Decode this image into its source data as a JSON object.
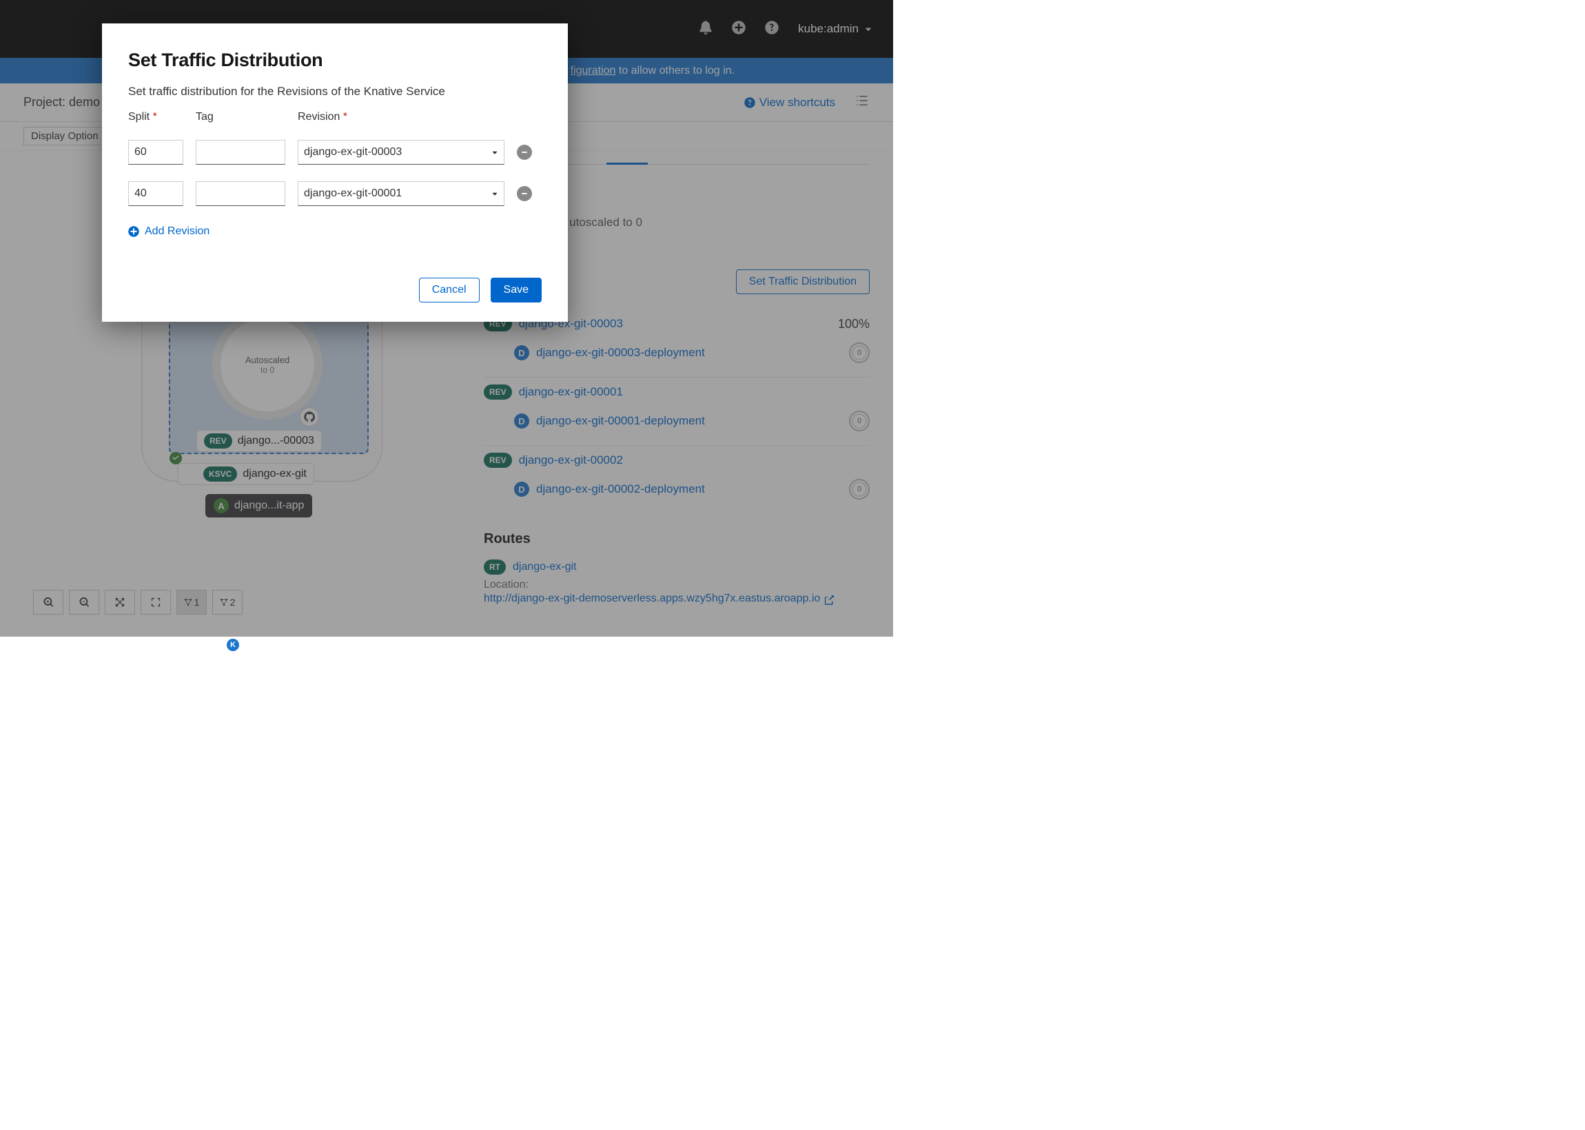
{
  "header": {
    "user": "kube:admin"
  },
  "bluebar": {
    "link": "figuration",
    "afterText": " to allow others to log in."
  },
  "subhead": {
    "projectLabel": "Project: demo",
    "viewShortcuts": "View shortcuts"
  },
  "filters": {
    "displayOptions": "Display Option"
  },
  "modal": {
    "title": "Set Traffic Distribution",
    "desc": "Set traffic distribution for the Revisions of the Knative Service",
    "labels": {
      "split": "Split",
      "tag": "Tag",
      "revision": "Revision"
    },
    "rows": [
      {
        "split": "60",
        "tag": "",
        "revision": "django-ex-git-00003"
      },
      {
        "split": "40",
        "tag": "",
        "revision": "django-ex-git-00001"
      }
    ],
    "addRevision": "Add Revision",
    "cancel": "Cancel",
    "save": "Save"
  },
  "topology": {
    "autoscaled1": "Autoscaled",
    "autoscaled2": "to 0",
    "revBadge": "REV",
    "revLabel": "django...-00003",
    "ksvcBadge": "KSVC",
    "ksvcLabel": "django-ex-git",
    "appBadge": "A",
    "appLabel": "django...it-app",
    "zoom1": "1",
    "zoom2": "2"
  },
  "right": {
    "autoscaled": "utoscaled to 0",
    "setTraffic": "Set Traffic Distribution",
    "revisions": [
      {
        "badge": "REV",
        "name": "django-ex-git-00003",
        "pct": "100%",
        "depBadge": "D",
        "dep": "django-ex-git-00003-deployment",
        "pods": "0"
      },
      {
        "badge": "REV",
        "name": "django-ex-git-00001",
        "pct": "",
        "depBadge": "D",
        "dep": "django-ex-git-00001-deployment",
        "pods": "0"
      },
      {
        "badge": "REV",
        "name": "django-ex-git-00002",
        "pct": "",
        "depBadge": "D",
        "dep": "django-ex-git-00002-deployment",
        "pods": "0"
      }
    ],
    "routesTitle": "Routes",
    "route": {
      "badge": "RT",
      "name": "django-ex-git",
      "locLabel": "Location:",
      "url": "http://django-ex-git-demoserverless.apps.wzy5hg7x.eastus.aroapp.io"
    }
  }
}
